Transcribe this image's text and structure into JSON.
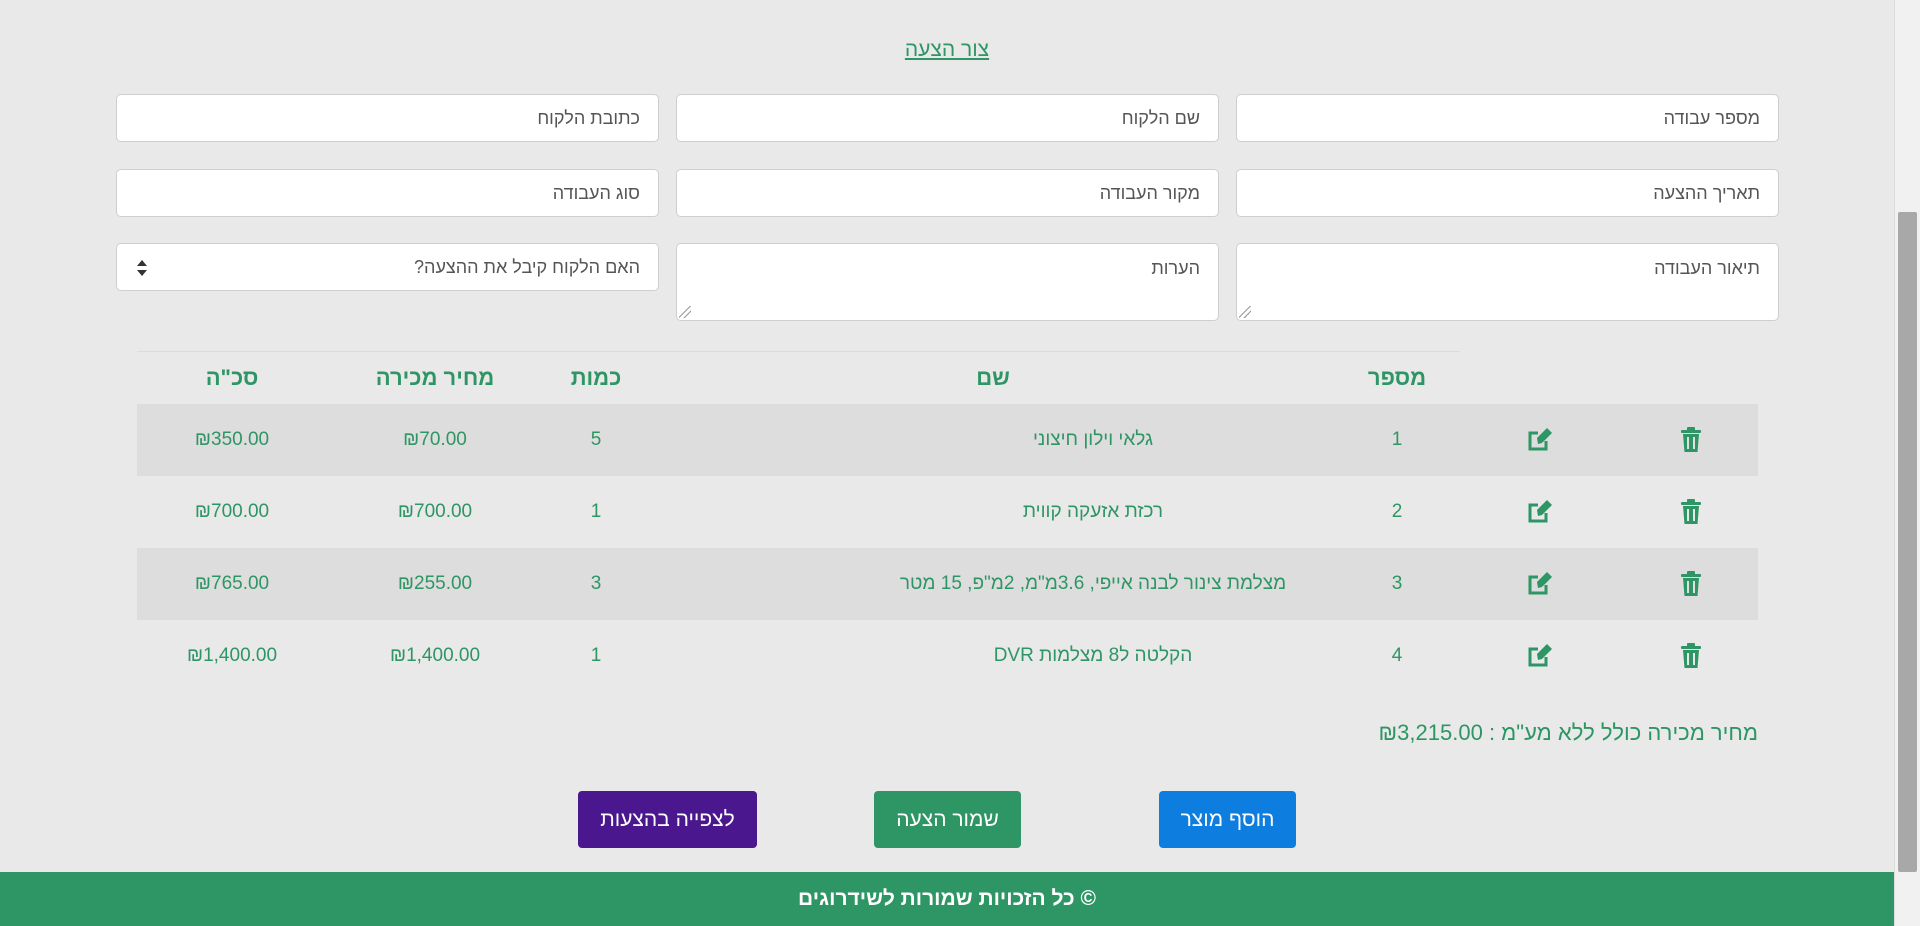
{
  "title_link": "צור הצעה",
  "fields": {
    "work_number": "מספר עבודה",
    "customer_name": "שם הלקוח",
    "customer_address": "כתובת הלקוח",
    "offer_date": "תאריך ההצעה",
    "work_source": "מקור העבודה",
    "work_type": "סוג העבודה",
    "work_description": "תיאור העבודה",
    "notes": "הערות",
    "accepted_select": "האם הלקוח קיבל את ההצעה?"
  },
  "table": {
    "headers": {
      "number": "מספר",
      "name": "שם",
      "quantity": "כמות",
      "sale_price": "מחיר מכירה",
      "total": "סכ\"ה"
    },
    "rows": [
      {
        "number": "1",
        "name": "גלאי וילון חיצוני",
        "quantity": "5",
        "price": "₪70.00",
        "total": "₪350.00"
      },
      {
        "number": "2",
        "name": "רכזת אזעקה קווית",
        "quantity": "1",
        "price": "₪700.00",
        "total": "₪700.00"
      },
      {
        "number": "3",
        "name": "מצלמת צינור לבנה אייפי, 3.6מ\"מ, 2מ\"פ, 15 מטר",
        "quantity": "3",
        "price": "₪255.00",
        "total": "₪765.00"
      },
      {
        "number": "4",
        "name": "הקלטה ל8 מצלמות DVR",
        "quantity": "1",
        "price": "₪1,400.00",
        "total": "₪1,400.00"
      }
    ],
    "icons": {
      "edit": "edit-icon",
      "delete": "trash-icon"
    }
  },
  "total_line": "מחיר מכירה כולל ללא מע\"מ : ₪3,215.00",
  "buttons": {
    "add_product": "הוסף מוצר",
    "save_offer": "שמור הצעה",
    "view_offers": "לצפייה בהצעות"
  },
  "footer": "© כל הזכויות שמורות לשידרוגים",
  "colors": {
    "accent_green": "#2e9565",
    "add_blue": "#0d7ee0",
    "view_purple": "#4a178f",
    "background": "#e9e9e9"
  }
}
